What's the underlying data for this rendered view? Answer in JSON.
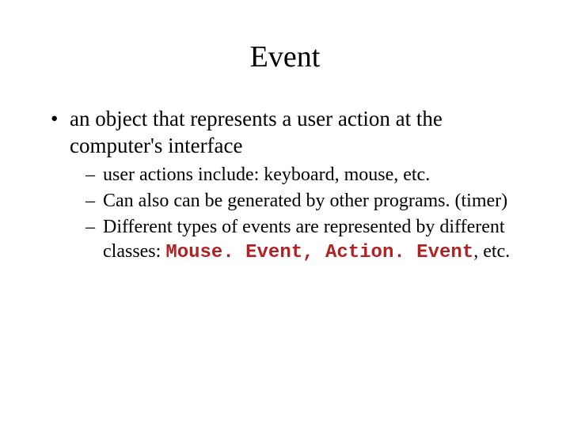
{
  "title": "Event",
  "bullets": {
    "main": "an object that represents a user action at the computer's interface",
    "sub1": "user actions include: keyboard, mouse, etc.",
    "sub2": "Can also can be generated by other programs. (timer)",
    "sub3_pre": "Different types of events are represented by different classes: ",
    "sub3_code1": "Mouse. Event, Action. Event",
    "sub3_post": ", etc."
  }
}
